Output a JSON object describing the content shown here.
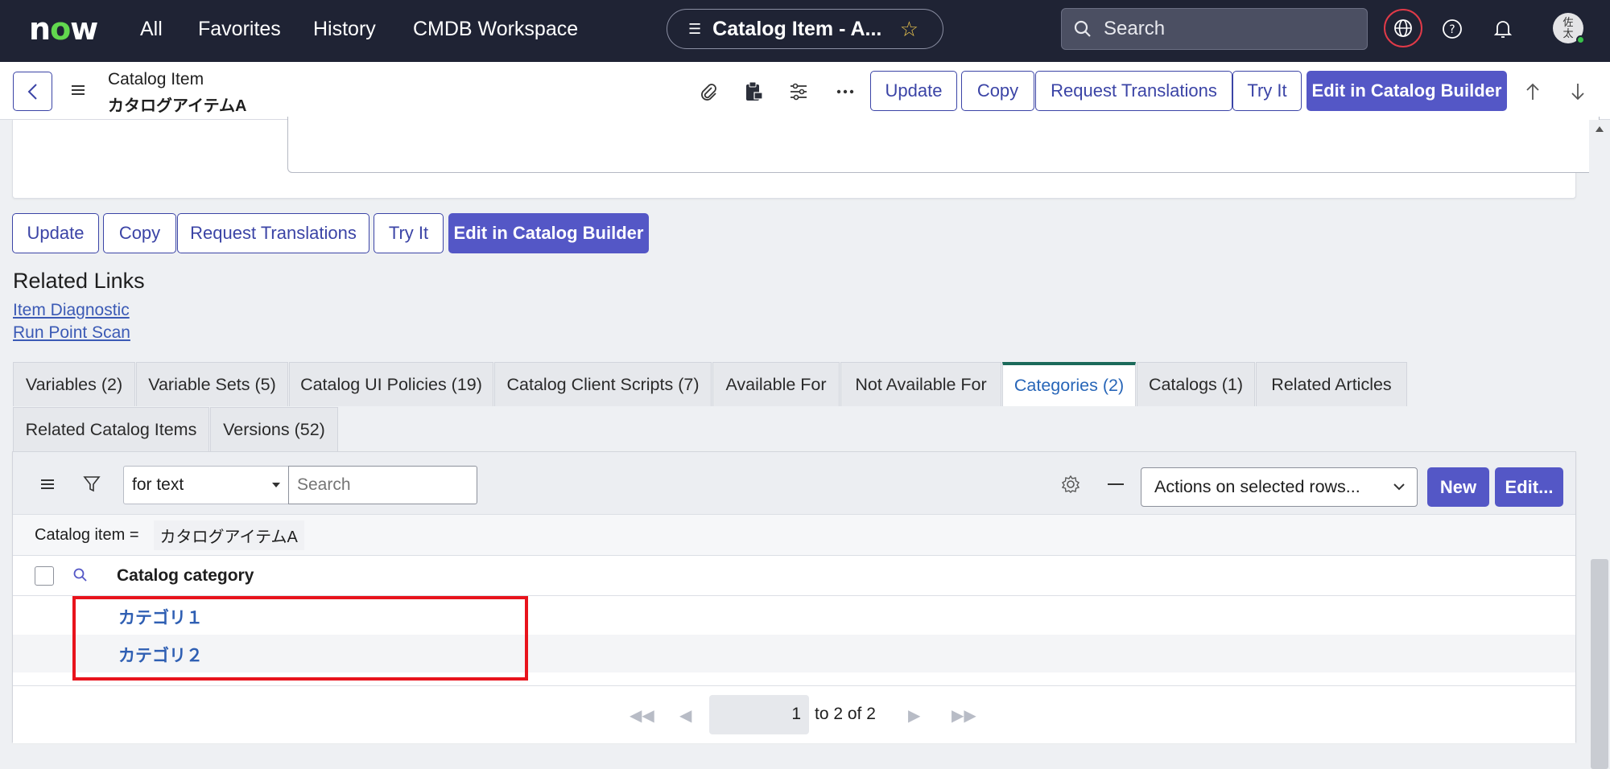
{
  "topnav": {
    "logo": "now",
    "links": [
      "All",
      "Favorites",
      "History",
      "CMDB Workspace"
    ],
    "record_title": "Catalog Item - A...",
    "search_placeholder": "Search",
    "avatar_text": "佐太"
  },
  "form_header": {
    "table_label": "Catalog Item",
    "record_name": "カタログアイテムA"
  },
  "buttons": {
    "update": "Update",
    "copy": "Copy",
    "request_translations": "Request Translations",
    "try_it": "Try It",
    "edit_builder": "Edit in Catalog Builder"
  },
  "related_links": {
    "title": "Related Links",
    "links": [
      "Item Diagnostic",
      "Run Point Scan"
    ]
  },
  "tabs": [
    {
      "label": "Variables (2)"
    },
    {
      "label": "Variable Sets (5)"
    },
    {
      "label": "Catalog UI Policies (19)"
    },
    {
      "label": "Catalog Client Scripts (7)"
    },
    {
      "label": "Available For"
    },
    {
      "label": "Not Available For"
    },
    {
      "label": "Categories (2)",
      "active": true
    },
    {
      "label": "Catalogs (1)"
    },
    {
      "label": "Related Articles"
    },
    {
      "label": "Related Catalog Items"
    },
    {
      "label": "Versions (52)"
    }
  ],
  "list": {
    "search_field": "for text",
    "search_placeholder": "Search",
    "actions_label": "Actions on selected rows...",
    "new_label": "New",
    "edit_label": "Edit...",
    "filter_label": "Catalog item =",
    "filter_value": "カタログアイテムA",
    "column": "Catalog category",
    "rows": [
      "カテゴリ１",
      "カテゴリ２"
    ],
    "page_value": "1",
    "page_text": "to 2 of 2"
  },
  "colors": {
    "nav_bg": "#1f2334",
    "accent": "#5457c6",
    "link": "#3b5ab5",
    "highlight": "#e8131c",
    "active_tab_border": "#1b6a5a"
  }
}
